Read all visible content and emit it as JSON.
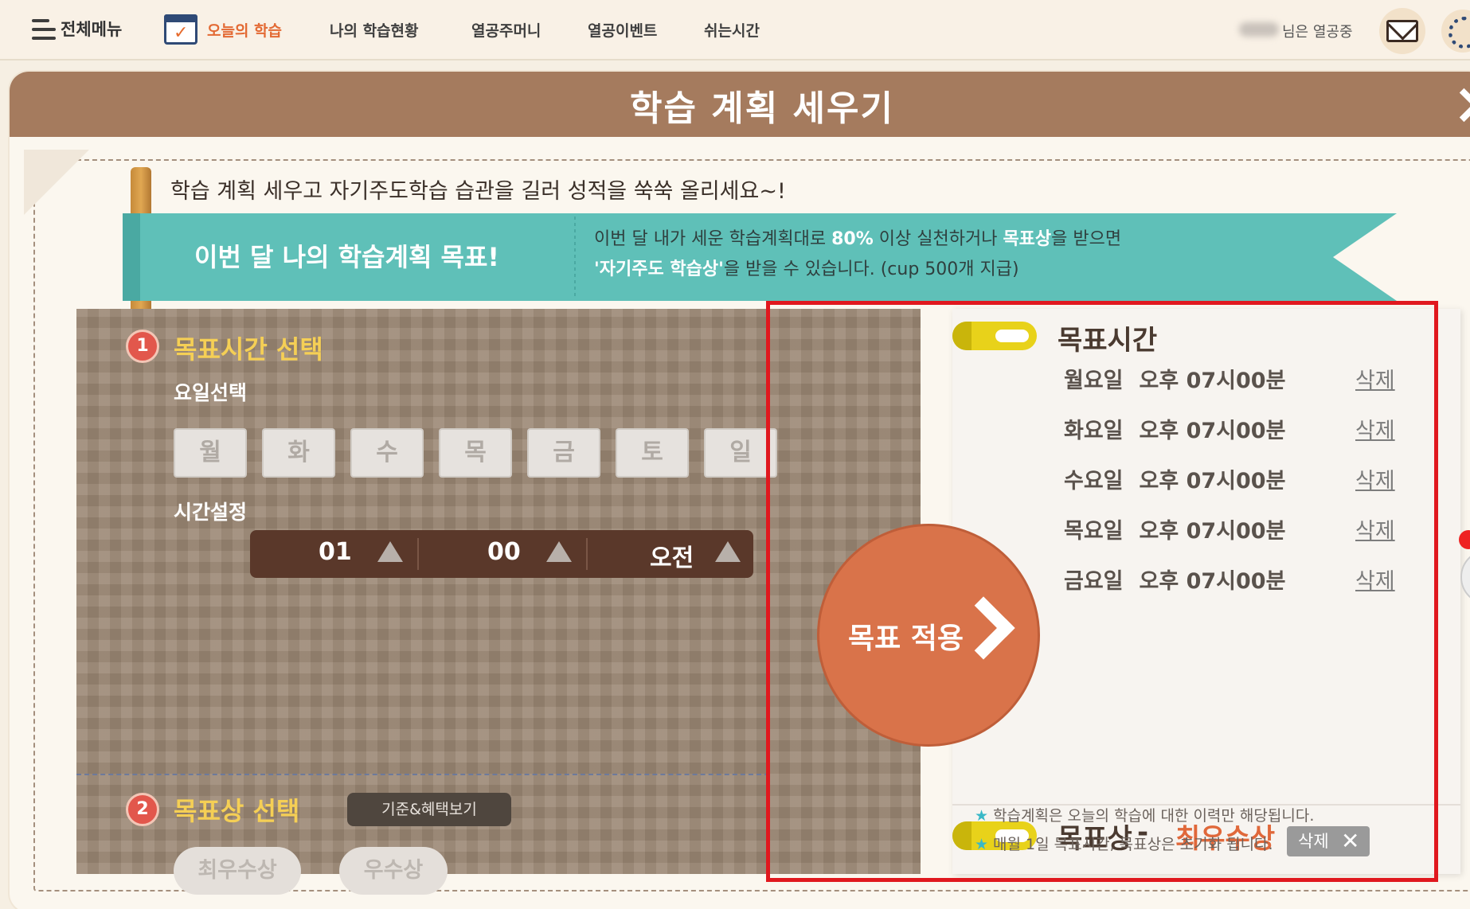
{
  "nav": {
    "menu_label": "전체메뉴",
    "items": [
      "오늘의 학습",
      "나의 학습현황",
      "열공주머니",
      "열공이벤트",
      "쉬는시간"
    ],
    "user_status": "님은 열공중"
  },
  "modal": {
    "title": "학습 계획 세우기",
    "intro": "학습 계획 세우고 자기주도학습 습관을 길러 성적을 쑥쑥 올리세요~!",
    "ribbon": {
      "left": "이번 달 나의 학습계획 목표!",
      "line1_a": "이번 달 내가 세운 학습계획대로 ",
      "line1_b": "80%",
      "line1_c": " 이상 실천하거나 ",
      "line1_d": "목표상",
      "line1_e": "을 받으면",
      "line2_a": "'자기주도 학습상'",
      "line2_b": "을 받을 수 있습니다. (cup 500개 지급)"
    }
  },
  "step1": {
    "badge": "1",
    "title": "목표시간 선택",
    "day_label": "요일선택",
    "days": [
      "월",
      "화",
      "수",
      "목",
      "금",
      "토",
      "일"
    ],
    "time_label": "시간설정",
    "hour": "01",
    "minute": "00",
    "ampm": "오전"
  },
  "step2": {
    "badge": "2",
    "title": "목표상 선택",
    "criteria_button": "기준&혜택보기",
    "awards": [
      "최우수상",
      "우수상"
    ]
  },
  "apply_button": "목표 적용",
  "goal_time": {
    "title": "목표시간",
    "rows": [
      {
        "day": "월요일",
        "time": "오후 07시00분",
        "delete": "삭제"
      },
      {
        "day": "화요일",
        "time": "오후 07시00분",
        "delete": "삭제"
      },
      {
        "day": "수요일",
        "time": "오후 07시00분",
        "delete": "삭제"
      },
      {
        "day": "목요일",
        "time": "오후 07시00분",
        "delete": "삭제"
      },
      {
        "day": "금요일",
        "time": "오후 07시00분",
        "delete": "삭제"
      }
    ]
  },
  "goal_award": {
    "title": "목표상",
    "dash": "-",
    "selected": "최우수상",
    "delete": "삭제",
    "notes": [
      "학습계획은 오늘의 학습에 대한 이력만 해당됩니다.",
      "매월 1일 목표시간, 목표상은 초기화 됩니다."
    ]
  },
  "colors": {
    "accent": "#e36a34",
    "header": "#a57b5e",
    "ribbon": "#5fc0b8",
    "highlight_frame": "#e0181e"
  }
}
